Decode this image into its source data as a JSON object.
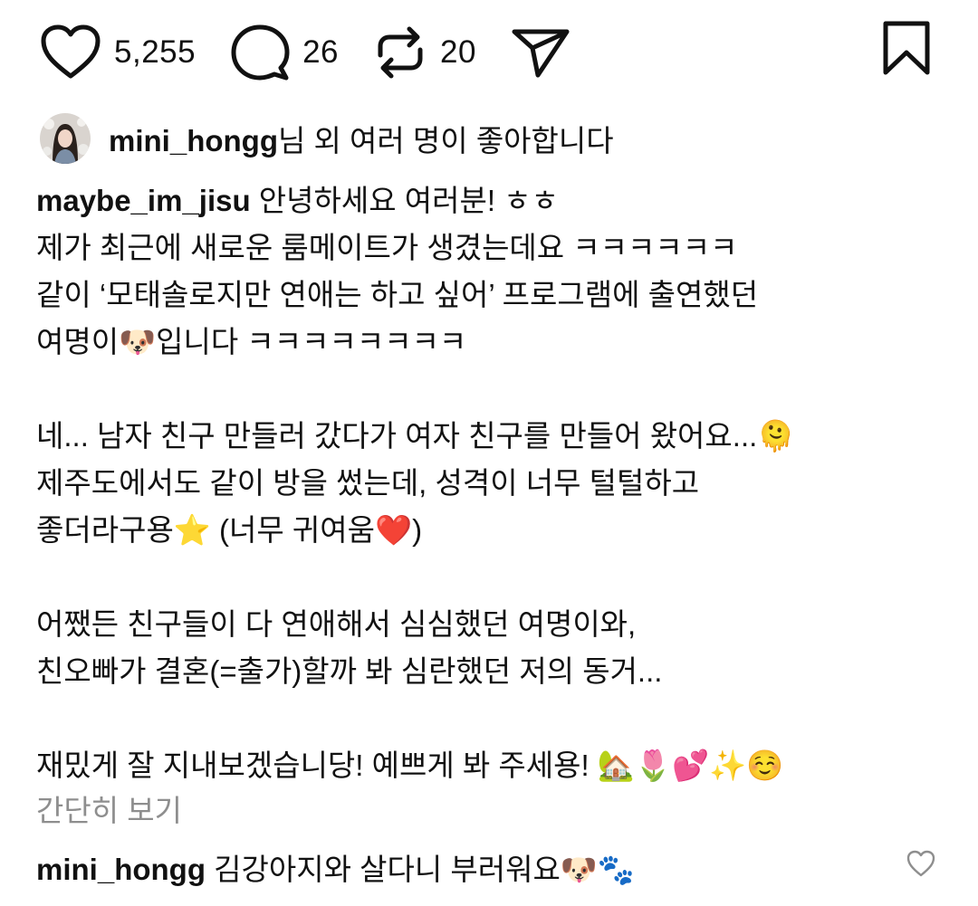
{
  "actions": {
    "likes": "5,255",
    "comments": "26",
    "reposts": "20"
  },
  "liked_by": {
    "user": "mini_hongg",
    "suffix": "님 외 여러 명이 좋아합니다"
  },
  "caption": {
    "author": "maybe_im_jisu",
    "first_line": " 안녕하세요 여러분! ㅎㅎ",
    "lines": [
      "제가 최근에 새로운 룸메이트가 생겼는데요 ㅋㅋㅋㅋㅋㅋ",
      "같이 ‘모태솔로지만 연애는 하고 싶어’ 프로그램에 출연했던",
      "여명이🐶입니다 ㅋㅋㅋㅋㅋㅋㅋㅋ",
      "",
      "네... 남자 친구 만들러 갔다가 여자 친구를 만들어 왔어요...🫠",
      "제주도에서도 같이 방을 썼는데, 성격이 너무 털털하고",
      "좋더라구용⭐ (너무 귀여움❤️)",
      "",
      "어쨌든 친구들이 다 연애해서 심심했던 여명이와,",
      "친오빠가 결혼(=출가)할까 봐 심란했던 저의 동거...",
      "",
      "재밌게 잘 지내보겠습니당! 예쁘게 봐 주세용! 🏡🌷💕✨☺️"
    ]
  },
  "collapse_label": "간단히 보기",
  "comment": {
    "user": "mini_hongg",
    "text": " 김강아지와 살다니 부러워요🐶🐾"
  },
  "icons": {
    "like": "heart-icon",
    "comment": "comment-bubble-icon",
    "repost": "repost-icon",
    "share": "send-icon",
    "save": "bookmark-icon",
    "comment_like": "heart-icon"
  }
}
